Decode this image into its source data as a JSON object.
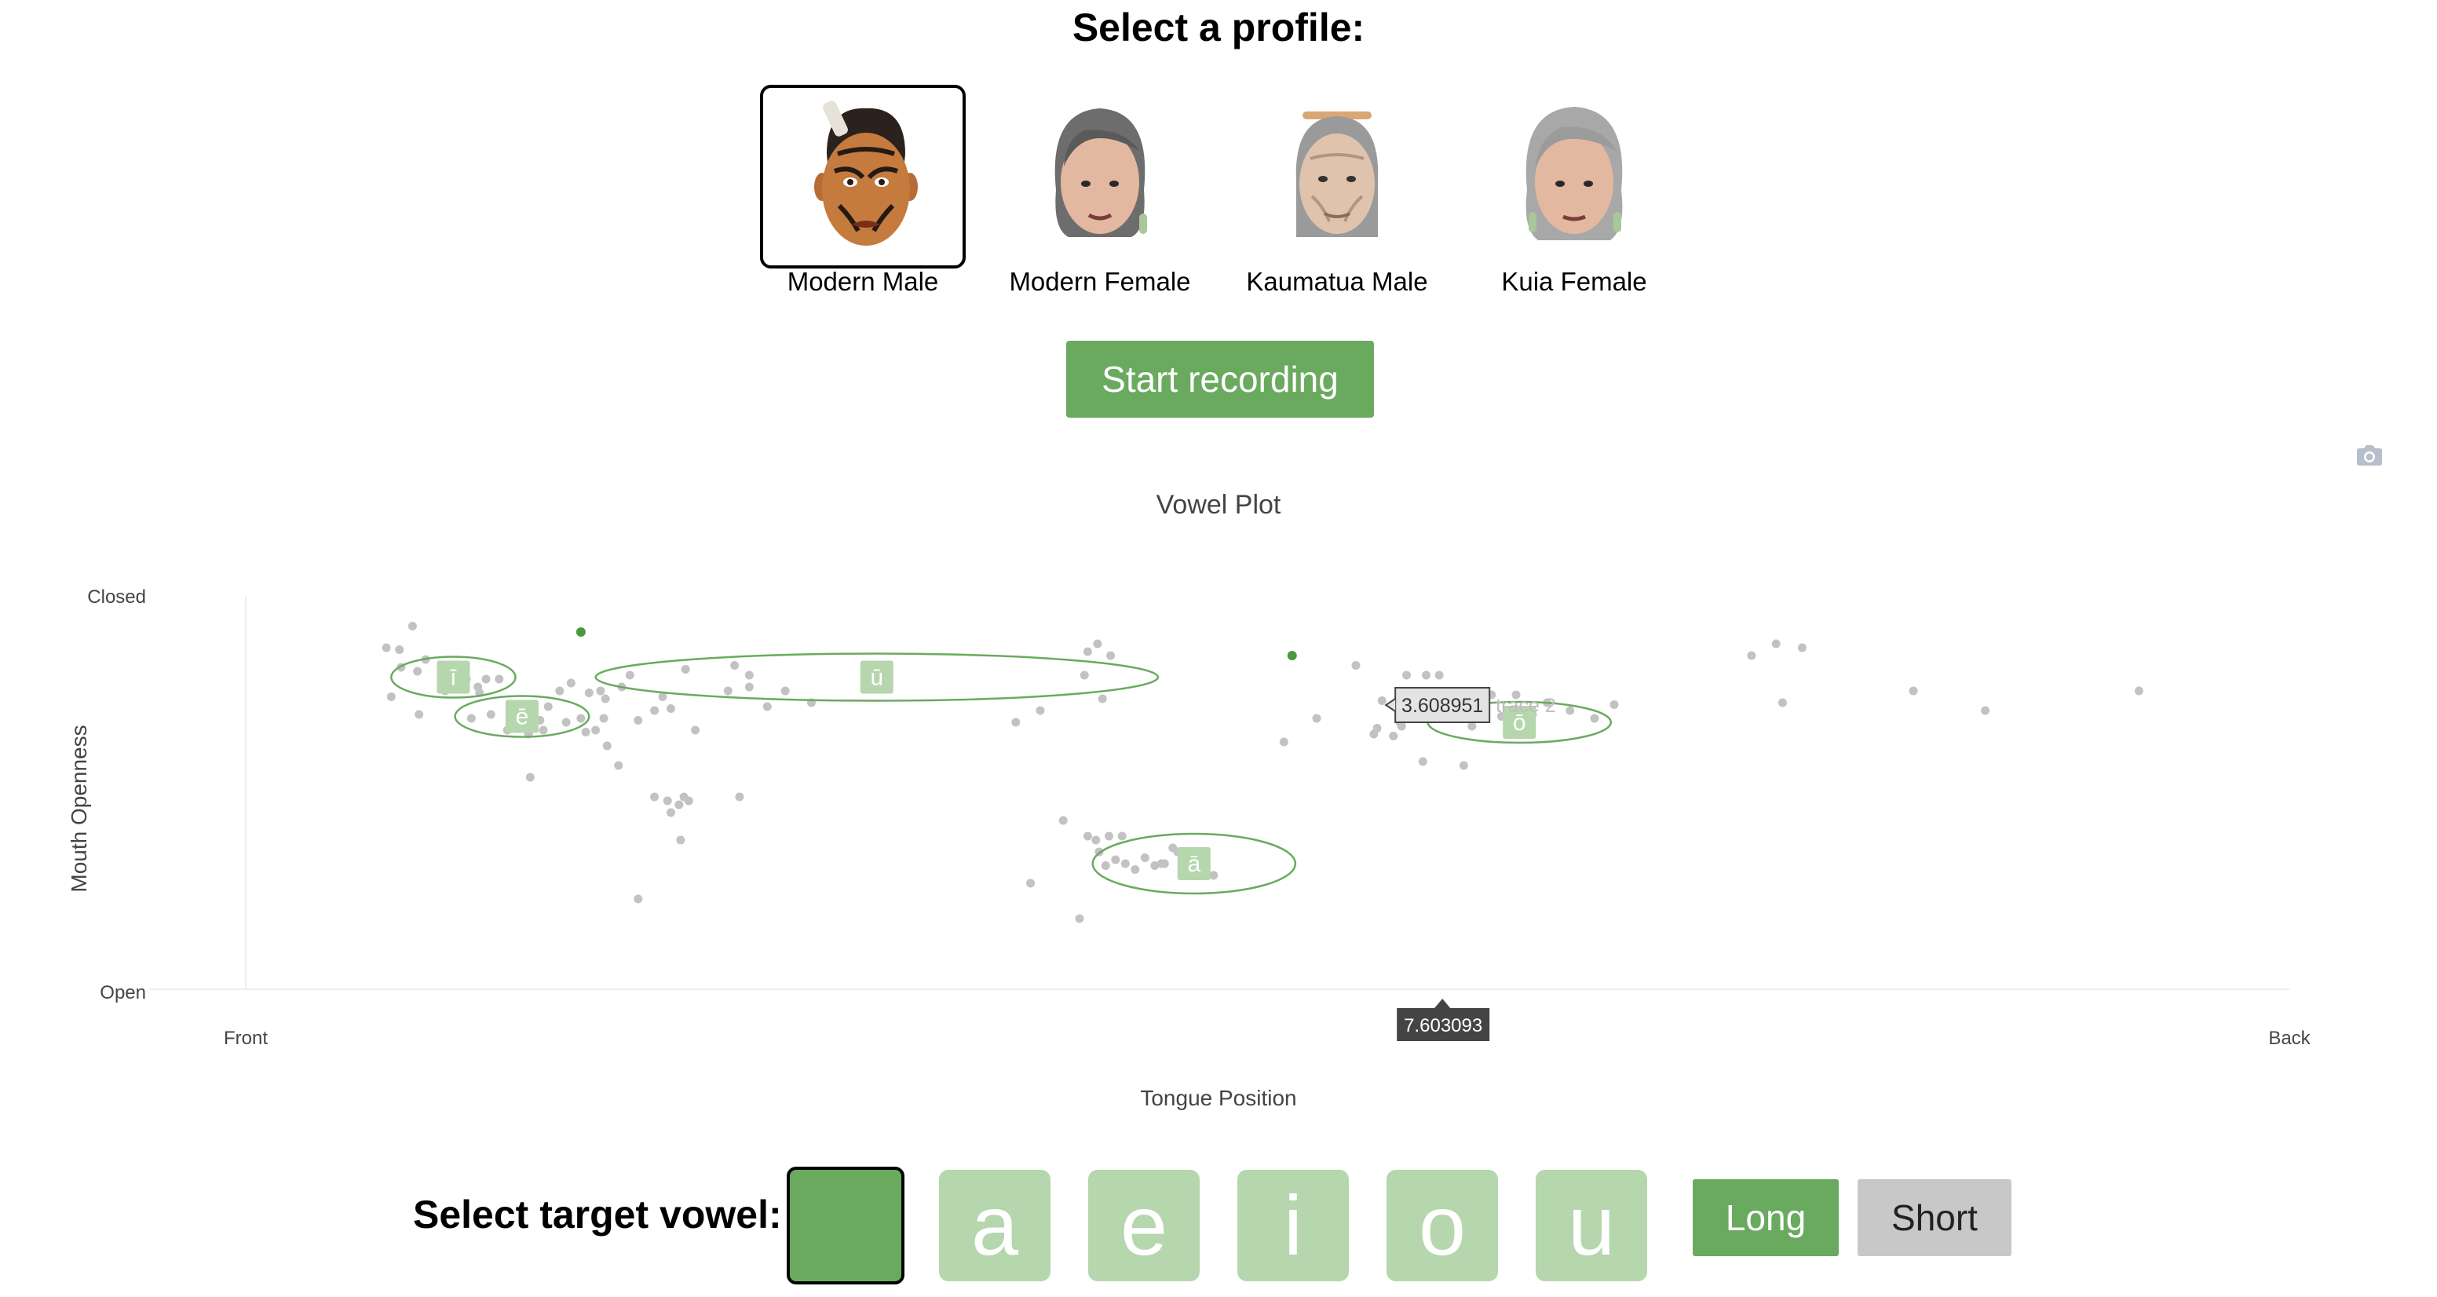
{
  "profile_selector": {
    "heading": "Select a profile:",
    "profiles": [
      {
        "label": "Modern Male",
        "selected": true
      },
      {
        "label": "Modern Female",
        "selected": false
      },
      {
        "label": "Kaumatua Male",
        "selected": false
      },
      {
        "label": "Kuia Female",
        "selected": false
      }
    ]
  },
  "controls": {
    "start_label": "Start recording"
  },
  "toolbar": {
    "camera_icon": "camera-icon"
  },
  "chart_data": {
    "type": "scatter",
    "title": "Vowel Plot",
    "xlabel": "Tongue Position",
    "ylabel": "Mouth Openness",
    "x_ticks": [
      "Front",
      "Back"
    ],
    "y_ticks": [
      "Closed",
      "Open"
    ],
    "x_range": [
      0,
      10
    ],
    "y_range": [
      0,
      10
    ],
    "grid": false,
    "colors": {
      "point": "#c2c2c2",
      "ellipse": "#6aaa5f",
      "label_bg": "#b6d6ae",
      "highlight": "#4a9a3e"
    },
    "vowel_regions": [
      {
        "label": "ī",
        "x": 1.27,
        "y": 7.95,
        "rx": 0.38,
        "ry": 0.52
      },
      {
        "label": "ē",
        "x": 1.69,
        "y": 6.95,
        "rx": 0.41,
        "ry": 0.52
      },
      {
        "label": "ū",
        "x": 3.86,
        "y": 7.95,
        "rx": 1.72,
        "ry": 0.6
      },
      {
        "label": "ā",
        "x": 5.8,
        "y": 3.2,
        "rx": 0.62,
        "ry": 0.76
      },
      {
        "label": "ō",
        "x": 7.79,
        "y": 6.8,
        "rx": 0.56,
        "ry": 0.52
      }
    ],
    "points": [
      [
        0.86,
        8.7
      ],
      [
        0.94,
        8.65
      ],
      [
        1.02,
        9.25
      ],
      [
        1.1,
        8.4
      ],
      [
        0.95,
        8.2
      ],
      [
        1.05,
        8.1
      ],
      [
        1.25,
        8.2
      ],
      [
        1.35,
        7.9
      ],
      [
        1.42,
        7.7
      ],
      [
        1.47,
        7.9
      ],
      [
        1.55,
        7.9
      ],
      [
        1.22,
        7.6
      ],
      [
        1.43,
        7.55
      ],
      [
        0.89,
        7.45
      ],
      [
        1.06,
        7.0
      ],
      [
        1.38,
        6.9
      ],
      [
        1.5,
        7.0
      ],
      [
        1.6,
        6.6
      ],
      [
        1.73,
        6.5
      ],
      [
        1.74,
        5.4
      ],
      [
        1.8,
        6.85
      ],
      [
        1.82,
        6.6
      ],
      [
        1.85,
        7.2
      ],
      [
        1.92,
        7.6
      ],
      [
        1.96,
        6.8
      ],
      [
        1.99,
        7.8
      ],
      [
        2.05,
        6.9
      ],
      [
        2.08,
        6.55
      ],
      [
        2.1,
        7.55
      ],
      [
        2.14,
        6.6
      ],
      [
        2.17,
        7.6
      ],
      [
        2.19,
        6.9
      ],
      [
        2.2,
        7.4
      ],
      [
        2.21,
        6.2
      ],
      [
        2.28,
        5.7
      ],
      [
        2.35,
        8.0
      ],
      [
        2.3,
        7.7
      ],
      [
        2.4,
        6.85
      ],
      [
        2.5,
        7.1
      ],
      [
        2.55,
        7.45
      ],
      [
        2.6,
        7.15
      ],
      [
        2.69,
        8.15
      ],
      [
        2.95,
        7.6
      ],
      [
        2.99,
        8.25
      ],
      [
        3.08,
        7.7
      ],
      [
        3.3,
        7.6
      ],
      [
        3.46,
        7.3
      ],
      [
        2.4,
        2.3
      ],
      [
        2.5,
        4.9
      ],
      [
        2.58,
        4.8
      ],
      [
        2.6,
        4.5
      ],
      [
        2.65,
        4.7
      ],
      [
        2.68,
        4.9
      ],
      [
        2.71,
        4.8
      ],
      [
        2.66,
        3.8
      ],
      [
        2.75,
        6.6
      ],
      [
        3.02,
        4.9
      ],
      [
        3.08,
        8.0
      ],
      [
        3.19,
        7.2
      ],
      [
        4.71,
        6.8
      ],
      [
        4.86,
        7.1
      ],
      [
        4.8,
        2.7
      ],
      [
        5.15,
        8.6
      ],
      [
        5.13,
        8.0
      ],
      [
        5.21,
        8.8
      ],
      [
        5.29,
        8.5
      ],
      [
        5.24,
        7.4
      ],
      [
        5.0,
        4.3
      ],
      [
        5.15,
        3.9
      ],
      [
        5.2,
        3.8
      ],
      [
        5.28,
        3.9
      ],
      [
        5.36,
        3.9
      ],
      [
        5.22,
        3.5
      ],
      [
        5.26,
        3.15
      ],
      [
        5.32,
        3.3
      ],
      [
        5.38,
        3.2
      ],
      [
        5.44,
        3.05
      ],
      [
        5.5,
        3.35
      ],
      [
        5.56,
        3.15
      ],
      [
        5.6,
        3.2
      ],
      [
        5.62,
        3.2
      ],
      [
        5.67,
        3.6
      ],
      [
        5.7,
        3.5
      ],
      [
        5.1,
        1.8
      ],
      [
        5.92,
        2.9
      ],
      [
        6.35,
        6.3
      ],
      [
        6.55,
        6.9
      ],
      [
        6.9,
        6.5
      ],
      [
        6.79,
        8.25
      ],
      [
        6.92,
        6.65
      ],
      [
        6.95,
        7.35
      ],
      [
        7.07,
        6.7
      ],
      [
        7.02,
        6.45
      ],
      [
        7.06,
        6.8
      ],
      [
        7.2,
        5.8
      ],
      [
        7.3,
        8.0
      ],
      [
        7.32,
        6.9
      ],
      [
        7.45,
        5.7
      ],
      [
        7.68,
        6.95
      ],
      [
        7.77,
        7.5
      ],
      [
        7.62,
        7.5
      ],
      [
        7.87,
        7.0
      ],
      [
        8.37,
        7.25
      ],
      [
        8.25,
        6.9
      ],
      [
        9.21,
        8.5
      ],
      [
        9.36,
        8.8
      ],
      [
        9.4,
        7.3
      ],
      [
        9.52,
        8.7
      ],
      [
        10.2,
        7.6
      ],
      [
        10.64,
        7.1
      ],
      [
        11.58,
        7.6
      ],
      [
        7.1,
        8.0
      ],
      [
        7.22,
        8.0
      ],
      [
        7.33,
        7.4
      ],
      [
        7.5,
        6.7
      ],
      [
        7.75,
        6.8
      ],
      [
        7.96,
        7.3
      ],
      [
        8.1,
        7.1
      ]
    ],
    "highlight_points": [
      [
        2.05,
        9.1
      ],
      [
        6.4,
        8.5
      ]
    ],
    "hover": {
      "trace_label": "trace 2",
      "y_value": "3.608951",
      "x_value": "7.603093"
    }
  },
  "target_vowel": {
    "label": "Select target vowel:",
    "keys": [
      {
        "label": "",
        "selected": true
      },
      {
        "label": "a",
        "selected": false
      },
      {
        "label": "e",
        "selected": false
      },
      {
        "label": "i",
        "selected": false
      },
      {
        "label": "o",
        "selected": false
      },
      {
        "label": "u",
        "selected": false
      }
    ],
    "length_long": "Long",
    "length_short": "Short",
    "length_selected": "Long"
  }
}
